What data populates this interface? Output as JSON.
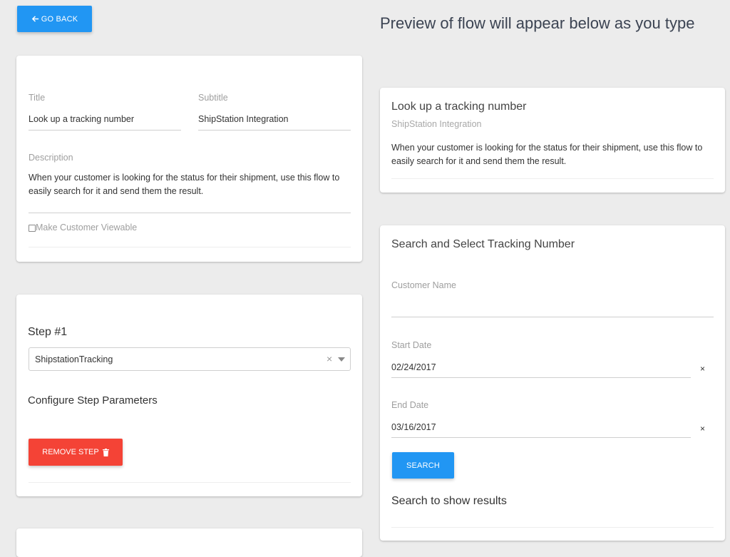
{
  "header": {
    "back_button": "GO BACK",
    "preview_heading": "Preview of flow will appear below as you type"
  },
  "editor": {
    "title_label": "Title",
    "title_value": "Look up a tracking number",
    "subtitle_label": "Subtitle",
    "subtitle_value": "ShipStation Integration",
    "description_label": "Description",
    "description_value": "When your customer is looking for the status for their shipment, use this flow to easily search for it and send them the result.",
    "customer_viewable_label": "Make Customer Viewable"
  },
  "step": {
    "heading": "Step #1",
    "selected": "ShipstationTracking",
    "configure_heading": "Configure Step Parameters",
    "remove_button": "REMOVE STEP"
  },
  "preview": {
    "title": "Look up a tracking number",
    "subtitle": "ShipStation Integration",
    "description": "When your customer is looking for the status for their shipment, use this flow to easily search for it and send them the result."
  },
  "search_card": {
    "heading": "Search and Select Tracking Number",
    "customer_name_label": "Customer Name",
    "customer_name_value": "",
    "start_date_label": "Start Date",
    "start_date_value": "02/24/2017",
    "end_date_label": "End Date",
    "end_date_value": "03/16/2017",
    "clear_glyph": "×",
    "search_button": "SEARCH",
    "results_text": "Search to show results"
  }
}
